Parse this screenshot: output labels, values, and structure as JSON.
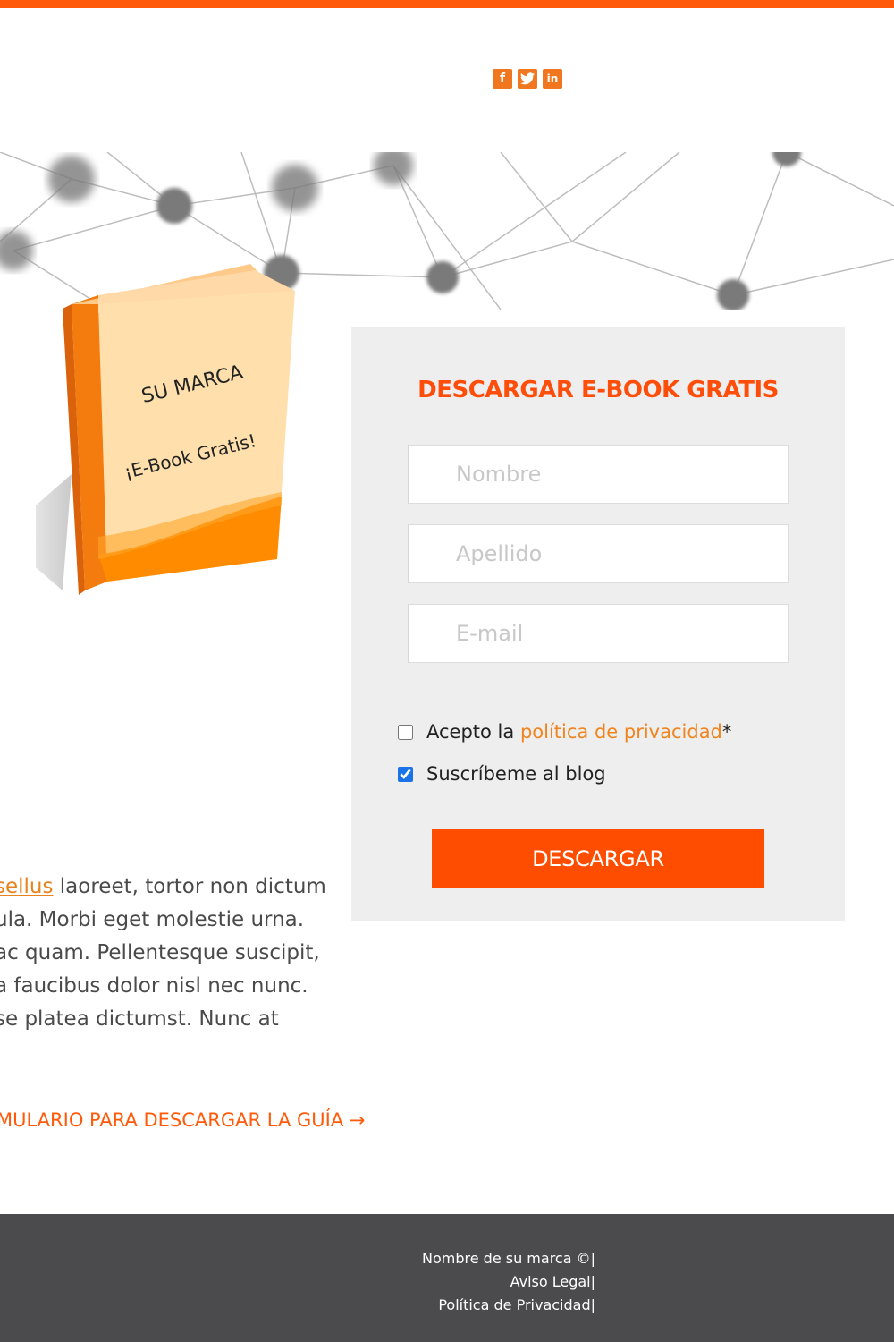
{
  "header": {
    "social": [
      {
        "name": "facebook-icon",
        "glyph": "f"
      },
      {
        "name": "twitter-icon",
        "glyph": "t"
      },
      {
        "name": "linkedin-icon",
        "glyph": "in"
      }
    ]
  },
  "book": {
    "brand": "SU MARCA",
    "subtitle": "¡E-Book Gratis!"
  },
  "form": {
    "title": "DESCARGAR E-BOOK GRATIS",
    "first_name_placeholder": "Nombre",
    "last_name_placeholder": "Apellido",
    "email_placeholder": "E-mail",
    "privacy_prefix": "Acepto la ",
    "privacy_link": "política de privacidad",
    "privacy_suffix": "*",
    "subscribe_label": "Suscríbeme al blog",
    "submit_label": "DESCARGAR"
  },
  "content": {
    "line1_link": "sellus",
    "line1_rest": " laoreet, tortor non dictum",
    "line2": "ula. Morbi eget molestie urna.",
    "line3": "ac quam. Pellentesque suscipit,",
    "line4": " a faucibus dolor nisl nec nunc.",
    "line5": "se platea dictumst. Nunc at",
    "cta": "MULARIO PARA DESCARGAR LA GUÍA →"
  },
  "footer": {
    "brand": "Nombre de su marca ©|",
    "legal": "Aviso Legal|",
    "privacy": "Política de Privacidad|"
  },
  "colors": {
    "accent": "#ff5a0a",
    "link": "#f0841e",
    "footer_bg": "#4b4b4d",
    "panel_bg": "#eeeeee"
  }
}
